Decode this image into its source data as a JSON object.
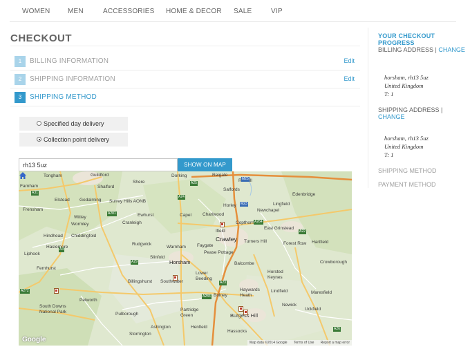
{
  "nav": {
    "items": [
      "WOMEN",
      "MEN",
      "ACCESSORIES",
      "HOME & DECOR",
      "SALE",
      "VIP"
    ]
  },
  "checkout": {
    "title": "CHECKOUT",
    "steps": [
      {
        "num": "1",
        "label": "BILLING INFORMATION",
        "edit": "Edit"
      },
      {
        "num": "2",
        "label": "SHIPPING INFORMATION",
        "edit": "Edit"
      },
      {
        "num": "3",
        "label": "SHIPPING METHOD"
      }
    ],
    "options": [
      {
        "label": "Specified day delivery",
        "checked": false
      },
      {
        "label": "Collection point delivery",
        "checked": true
      }
    ],
    "search": {
      "value": "rh13 5uz",
      "button": "SHOW ON MAP"
    }
  },
  "map": {
    "places": [
      "Farnham",
      "Tongham",
      "Guildford",
      "Shere",
      "Dorking",
      "Reigate",
      "Redhill",
      "Salfords",
      "Shalford",
      "Elstead",
      "Godalming",
      "Surrey Hills AONB",
      "Frensham",
      "Witley",
      "Wormley",
      "Ewhurst",
      "Capel",
      "Charlwood",
      "Horley",
      "Newchapel",
      "Lingfield",
      "Edenbridge",
      "Hindhead",
      "Chiddingfold",
      "Cranleigh",
      "Ifield",
      "Copthorne",
      "East Grinstead",
      "Haslemere",
      "Rudgwick",
      "Warnham",
      "Faygate",
      "Crawley",
      "Turners Hill",
      "Forest Row",
      "Hartfield",
      "Liphook",
      "Slinfold",
      "Horsham",
      "Pease Pottage",
      "Balcombe",
      "Crowborough",
      "Fernhurst",
      "Billingshurst",
      "Southwater",
      "Lower Beeding",
      "Horsted Keynes",
      "Haywards Heath",
      "Lindfield",
      "Petworth",
      "Bolney",
      "Newick",
      "Maresfield",
      "South Downs National Park",
      "Pulborough",
      "Partridge Green",
      "Burgess Hill",
      "Uckfield",
      "Ashington",
      "Henfield",
      "Storrington",
      "Hassocks"
    ],
    "roads": [
      "A31",
      "A3",
      "A281",
      "A24",
      "A25",
      "A29",
      "A272",
      "A264",
      "A23",
      "A22",
      "A26",
      "A283",
      "M25",
      "M23"
    ],
    "google": "Google",
    "attribution": [
      "Map data ©2014 Google",
      "Terms of Use",
      "Report a map error"
    ]
  },
  "sidebar": {
    "title": "YOUR CHECKOUT PROGRESS",
    "billing": {
      "label": "BILLING ADDRESS",
      "sep": "|",
      "change": "CHANGE",
      "lines": [
        "horsham, rh13 5uz",
        "United Kingdom",
        "T: 1"
      ]
    },
    "shipping": {
      "label": "SHIPPING ADDRESS",
      "sep": "|",
      "change": "CHANGE",
      "lines": [
        "horsham, rh13 5uz",
        "United Kingdom",
        "T: 1"
      ]
    },
    "method": "SHIPPING METHOD",
    "payment": "PAYMENT METHOD"
  },
  "colors": {
    "accent": "#3399cc",
    "step_inactive": "#a9d4ea",
    "text": "#636363"
  }
}
